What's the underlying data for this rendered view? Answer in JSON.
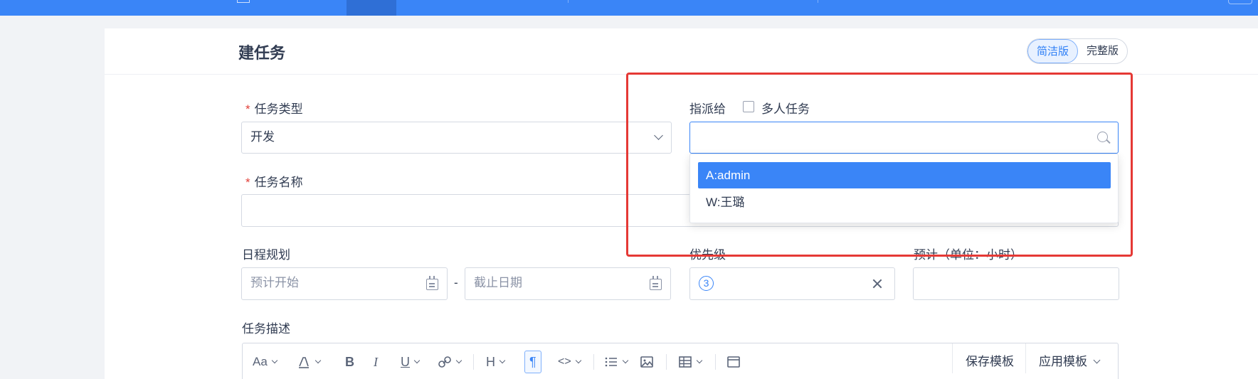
{
  "page": {
    "title": "建任务"
  },
  "view_toggle": {
    "simple": "简洁版",
    "full": "完整版",
    "active": "simple"
  },
  "form": {
    "task_type": {
      "label": "任务类型",
      "value": "开发"
    },
    "assignee": {
      "label": "指派给",
      "multi_label": "多人任务",
      "multi_checked": false,
      "value": ""
    },
    "task_name": {
      "label": "任务名称",
      "value": ""
    },
    "schedule": {
      "label": "日程规划",
      "start_placeholder": "预计开始",
      "end_placeholder": "截止日期",
      "separator": "-"
    },
    "priority": {
      "label": "优先级",
      "value": "3"
    },
    "estimate": {
      "label": "预计（单位：小时）",
      "value": ""
    },
    "description": {
      "label": "任务描述"
    }
  },
  "assignee_options": [
    {
      "label": "A:admin",
      "selected": true
    },
    {
      "label": "W:王璐",
      "selected": false
    }
  ],
  "editor_toolbar": {
    "font_size_glyph": "Aa",
    "bold": "B",
    "italic": "I",
    "underline": "U",
    "heading": "H",
    "paragraph": "¶",
    "code": "<>",
    "save_template": "保存模板",
    "apply_template": "应用模板"
  },
  "colors": {
    "brand": "#3a85f7",
    "highlight": "#e53935",
    "required": "#e2403a"
  }
}
